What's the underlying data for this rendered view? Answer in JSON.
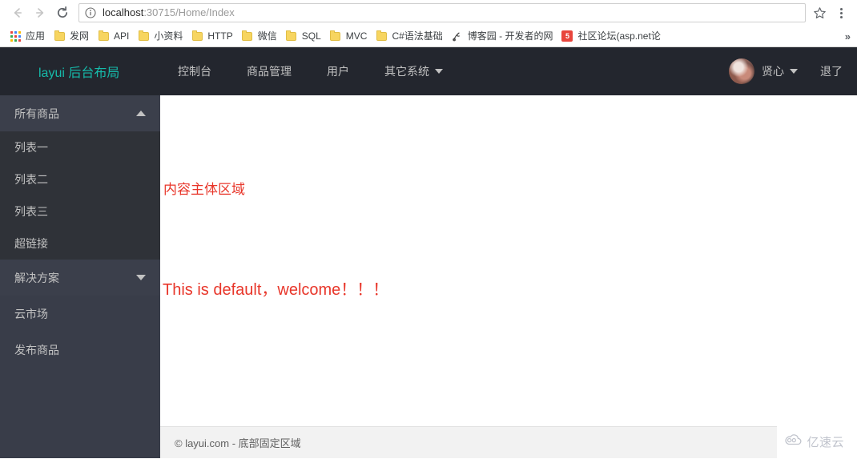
{
  "browser": {
    "url_host": "localhost",
    "url_path": ":30715/Home/Index",
    "back_icon": "back-arrow-icon",
    "forward_icon": "forward-arrow-icon",
    "reload_icon": "reload-icon",
    "info_icon": "page-info-icon",
    "star_icon": "bookmark-star-icon",
    "menu_icon": "browser-menu-icon",
    "overflow_label": "»",
    "bookmarks": [
      {
        "label": "应用",
        "icon": "apps-grid-icon"
      },
      {
        "label": "发网",
        "icon": "folder-icon"
      },
      {
        "label": "API",
        "icon": "folder-icon"
      },
      {
        "label": "小资料",
        "icon": "folder-icon"
      },
      {
        "label": "HTTP",
        "icon": "folder-icon"
      },
      {
        "label": "微信",
        "icon": "folder-icon"
      },
      {
        "label": "SQL",
        "icon": "folder-icon"
      },
      {
        "label": "MVC",
        "icon": "folder-icon"
      },
      {
        "label": "C#语法基础",
        "icon": "folder-icon"
      },
      {
        "label": "博客园 - 开发者的网",
        "icon": "cnblogs-icon"
      },
      {
        "label": "社区论坛(asp.net论",
        "icon": "forum-icon"
      }
    ]
  },
  "header": {
    "logo": "layui 后台布局",
    "nav": [
      {
        "label": "控制台",
        "has_caret": false
      },
      {
        "label": "商品管理",
        "has_caret": false
      },
      {
        "label": "用户",
        "has_caret": false
      },
      {
        "label": "其它系统",
        "has_caret": true
      }
    ],
    "user_name": "贤心",
    "logout": "退了",
    "avatar_name": "user-avatar"
  },
  "sidebar": {
    "groups": [
      {
        "title": "所有商品",
        "expanded": true,
        "items": [
          {
            "label": "列表一"
          },
          {
            "label": "列表二"
          },
          {
            "label": "列表三"
          },
          {
            "label": "超链接"
          }
        ]
      },
      {
        "title": "解决方案",
        "expanded": false,
        "items": []
      }
    ],
    "plain_items": [
      {
        "label": "云市场"
      },
      {
        "label": "发布商品"
      }
    ]
  },
  "main": {
    "line1": "内容主体区域",
    "line2": "This is default，welcome！！！",
    "text_color": "#e8362a"
  },
  "footer": {
    "text": "© layui.com - 底部固定区域"
  },
  "watermark": {
    "text": "亿速云",
    "icon": "cloud-icon"
  },
  "colors": {
    "header_bg": "#23262E",
    "sidebar_bg": "#393D49",
    "sidebar_sub_bg": "#2F3238",
    "logo": "#16baaa",
    "accent_red": "#e8362a"
  }
}
